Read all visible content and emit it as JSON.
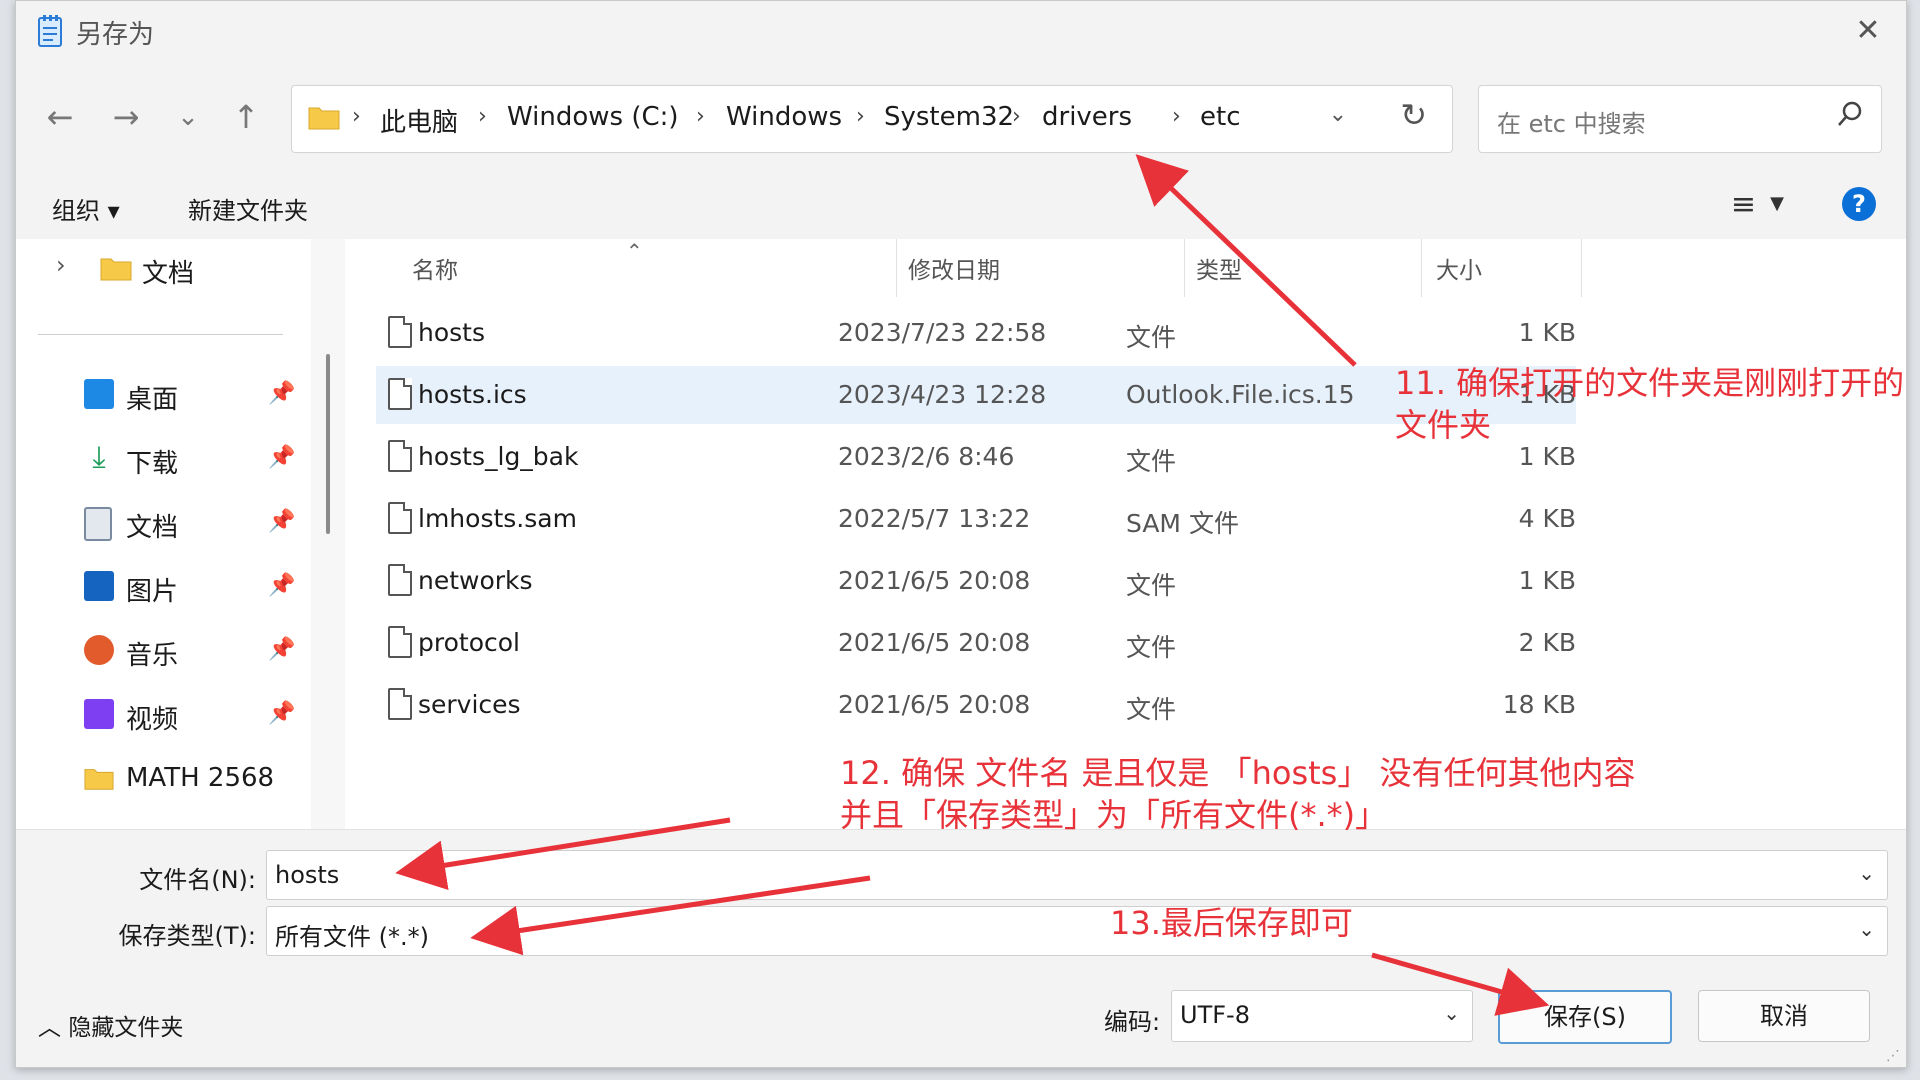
{
  "window": {
    "title": "另存为",
    "close_glyph": "✕"
  },
  "nav": {
    "back": "←",
    "forward": "→",
    "recent": "⌄",
    "up": "↑",
    "breadcrumb": [
      "此电脑",
      "Windows (C:)",
      "Windows",
      "System32",
      "drivers",
      "etc"
    ],
    "separator": "›",
    "search_placeholder": "在 etc 中搜索"
  },
  "toolbar": {
    "organize": "组织 ▾",
    "new_folder": "新建文件夹",
    "help": "?"
  },
  "sidebar": {
    "top_item": "文档",
    "items": [
      {
        "label": "桌面",
        "icon": "desktop-icon",
        "color": "#1e88e5"
      },
      {
        "label": "下载",
        "icon": "download-icon",
        "color": "#1e9e5a"
      },
      {
        "label": "文档",
        "icon": "document-icon",
        "color": "#7a8aa0"
      },
      {
        "label": "图片",
        "icon": "pictures-icon",
        "color": "#1565c0"
      },
      {
        "label": "音乐",
        "icon": "music-icon",
        "color": "#e25b2d"
      },
      {
        "label": "视频",
        "icon": "video-icon",
        "color": "#7e3ff2"
      },
      {
        "label": "MATH 2568",
        "icon": "folder-icon",
        "color": "#f7c948"
      }
    ]
  },
  "columns": {
    "name": "名称",
    "date": "修改日期",
    "type": "类型",
    "size": "大小"
  },
  "files": [
    {
      "name": "hosts",
      "date": "2023/7/23 22:58",
      "type": "文件",
      "size": "1 KB"
    },
    {
      "name": "hosts.ics",
      "date": "2023/4/23 12:28",
      "type": "Outlook.File.ics.15",
      "size": "1 KB",
      "selected": true
    },
    {
      "name": "hosts_lg_bak",
      "date": "2023/2/6 8:46",
      "type": "文件",
      "size": "1 KB"
    },
    {
      "name": "lmhosts.sam",
      "date": "2022/5/7 13:22",
      "type": "SAM 文件",
      "size": "4 KB"
    },
    {
      "name": "networks",
      "date": "2021/6/5 20:08",
      "type": "文件",
      "size": "1 KB"
    },
    {
      "name": "protocol",
      "date": "2021/6/5 20:08",
      "type": "文件",
      "size": "2 KB"
    },
    {
      "name": "services",
      "date": "2021/6/5 20:08",
      "type": "文件",
      "size": "18 KB"
    }
  ],
  "form": {
    "filename_label": "文件名(N):",
    "filename_value": "hosts",
    "savetype_label": "保存类型(T):",
    "savetype_value": "所有文件  (*.*)",
    "hide_folders": "隐藏文件夹",
    "encoding_label": "编码:",
    "encoding_value": "UTF-8",
    "save": "保存(S)",
    "cancel": "取消"
  },
  "annotations": {
    "step11_line1": "11. 确保打开的文件夹是刚刚打开的",
    "step11_line2": "文件夹",
    "step12_line1": "12. 确保 文件名 是且仅是 「hosts」 没有任何其他内容",
    "step12_line2": "并且「保存类型」为「所有文件(*.*)」",
    "step13": "13.最后保存即可",
    "color": "#e8323a"
  }
}
